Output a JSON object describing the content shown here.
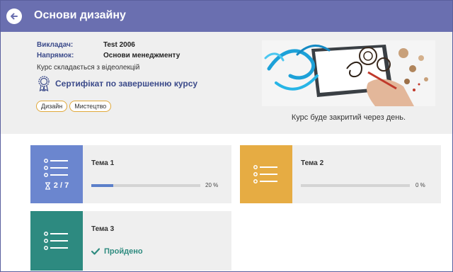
{
  "header": {
    "title": "Основи дизайну"
  },
  "info": {
    "teacher_label": "Викладач:",
    "teacher_value": "Test 2006",
    "direction_label": "Напрямок:",
    "direction_value": "Основи менеджменту",
    "description": "Курс складається з відеолекцій",
    "certificate": "Сертифікат по завершенню курсу",
    "tags": [
      "Дизайн",
      "Мистецтво"
    ],
    "closing_note": "Курс буде закритий через день."
  },
  "topics": [
    {
      "title": "Тема 1",
      "score": "2 / 7",
      "progress_text": "20 %",
      "progress": 0.2,
      "color": "#6b86cf"
    },
    {
      "title": "Тема 2",
      "progress_text": "0 %",
      "progress": 0.0,
      "color": "#e6ac43"
    },
    {
      "title": "Тема 3",
      "status": "Пройдено",
      "color": "#2d8a80"
    }
  ]
}
